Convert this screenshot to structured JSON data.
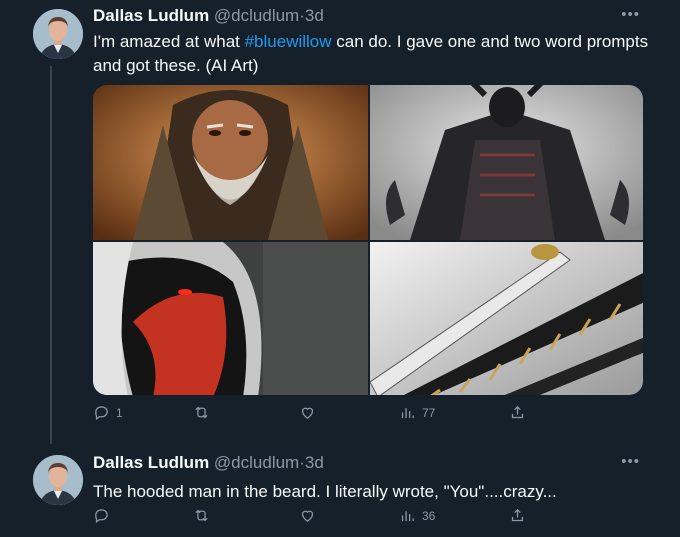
{
  "colors": {
    "background": "#15202b",
    "text": "#f7f9f9",
    "secondary": "#8b98a5",
    "link": "#1d9bf0"
  },
  "tweets": [
    {
      "name": "Dallas Ludlum",
      "handle": "@dcludlum",
      "separator": "·",
      "time": "3d",
      "text_before": "I'm amazed at what ",
      "hashtag": "#bluewillow",
      "text_after": " can do. I gave one and two word prompts and got these. (AI Art)",
      "images": [
        "bearded-hooded-man",
        "dark-armored-warrior",
        "red-masked-hooded-figure",
        "katana-sword"
      ],
      "reply_count": "1",
      "view_count": "77"
    },
    {
      "name": "Dallas Ludlum",
      "handle": "@dcludlum",
      "separator": "·",
      "time": "3d",
      "text": "The hooded man in the beard. I literally wrote, \"You\"....crazy...",
      "view_count": "36"
    }
  ],
  "icons": [
    "more-icon",
    "reply-icon",
    "retweet-icon",
    "like-icon",
    "views-icon",
    "share-icon"
  ]
}
